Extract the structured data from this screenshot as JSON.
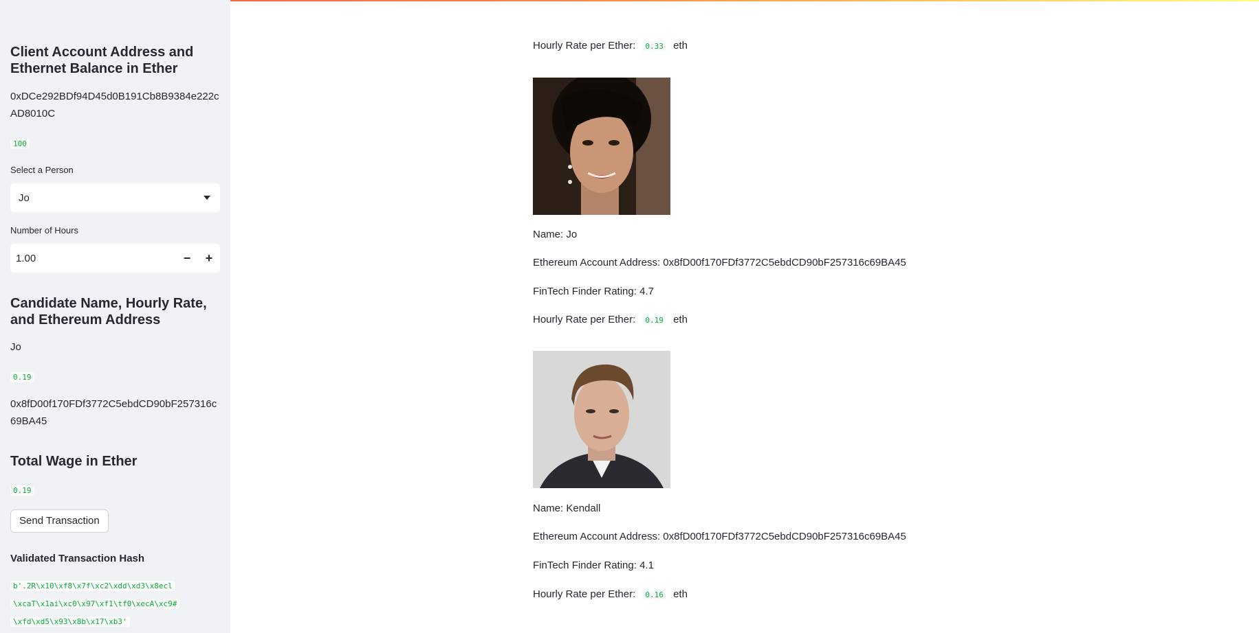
{
  "sidebar": {
    "client_header": "Client Account Address and Ethernet Balance in Ether",
    "client_address": "0xDCe292BDf94D45d0B191Cb8B9384e222cAD8010C",
    "client_balance": "100",
    "select_person_label": "Select a Person",
    "selected_person": "Jo",
    "hours_label": "Number of Hours",
    "hours_value": "1.00",
    "minus": "−",
    "plus": "+",
    "candidate_header": "Candidate Name, Hourly Rate, and Ethereum Address",
    "candidate_name": "Jo",
    "candidate_rate": "0.19",
    "candidate_address": "0x8fD00f170FDf3772C5ebdCD90bF257316c69BA45",
    "wage_header": "Total Wage in Ether",
    "wage_value": "0.19",
    "send_button": "Send Transaction",
    "hash_header": "Validated Transaction Hash",
    "hash_lines": [
      "b'.2R\\x10\\xf8\\x7f\\xc2\\xdd\\xd3\\x8ecl",
      "\\xcaT\\x1ai\\xc0\\x97\\xf1\\tf0\\xecA\\xc9#",
      "\\xfd\\xd5\\x93\\x8b\\x17\\xb3'"
    ]
  },
  "main": {
    "top_rate_label": "Hourly Rate per Ether:",
    "top_rate_value": "0.33",
    "top_rate_unit": "eth",
    "candidates": [
      {
        "name_label": "Name: Jo",
        "address_label": "Ethereum Account Address: 0x8fD00f170FDf3772C5ebdCD90bF257316c69BA45",
        "rating_label": "FinTech Finder Rating: 4.7",
        "rate_label": "Hourly Rate per Ether:",
        "rate_value": "0.19",
        "rate_unit": "eth"
      },
      {
        "name_label": "Name: Kendall",
        "address_label": "Ethereum Account Address: 0x8fD00f170FDf3772C5ebdCD90bF257316c69BA45",
        "rating_label": "FinTech Finder Rating: 4.1",
        "rate_label": "Hourly Rate per Ether:",
        "rate_value": "0.16",
        "rate_unit": "eth"
      }
    ]
  },
  "colors": {
    "sidebar_bg": "#f0f2f6",
    "code_green": "#09ab3b",
    "text": "#262730"
  }
}
